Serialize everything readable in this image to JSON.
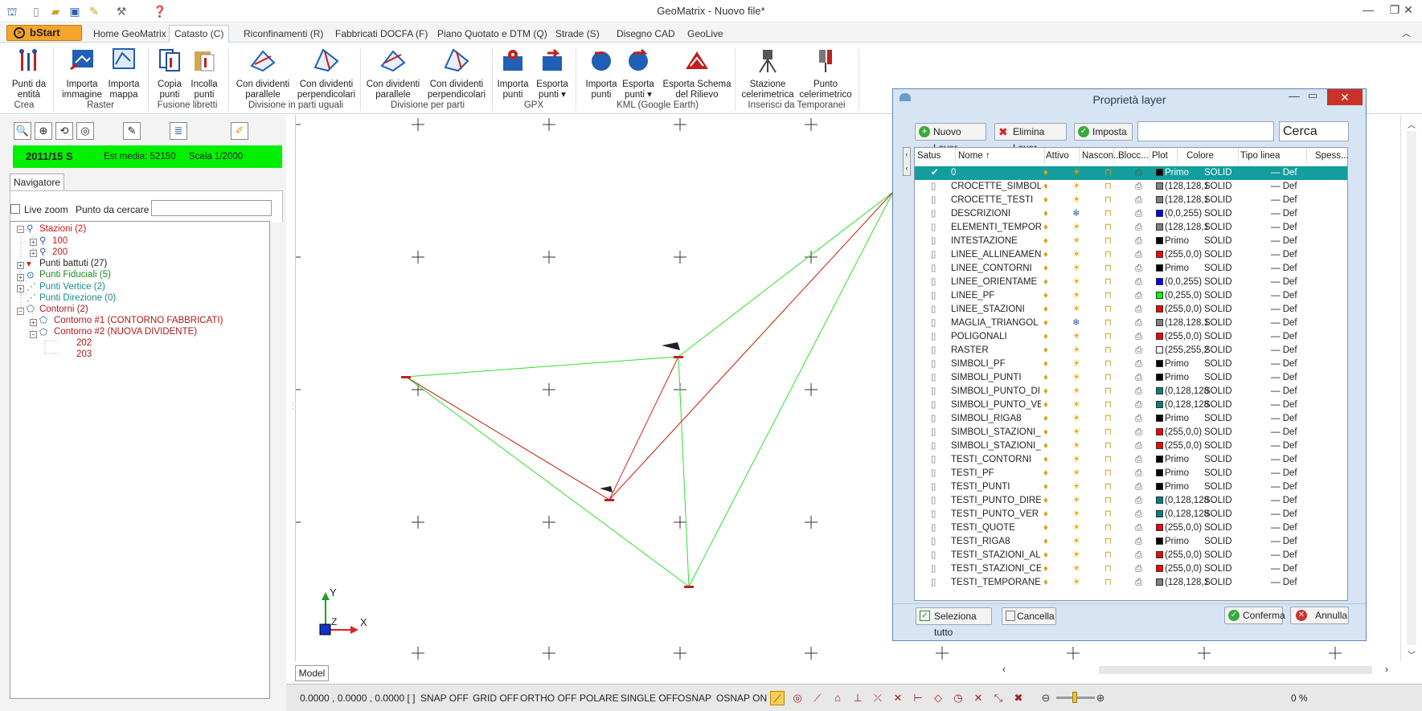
{
  "app": {
    "title": "GeoMatrix - Nuovo file*"
  },
  "tabs": [
    "Home GeoMatrix",
    "Catasto (C)",
    "Riconfinamenti (R)",
    "Fabbricati DOCFA (F)",
    "Piano Quotato e DTM (Q)",
    "Strade (S)",
    "Disegno CAD",
    "GeoLive"
  ],
  "bstart": "bStart",
  "ribbon": {
    "buttons": [
      {
        "l1": "Punti da",
        "l2": "entità"
      },
      {
        "l1": "Importa",
        "l2": "immagine"
      },
      {
        "l1": "Importa",
        "l2": "mappa"
      },
      {
        "l1": "Copia",
        "l2": "punti"
      },
      {
        "l1": "Incolla",
        "l2": "punti"
      },
      {
        "l1": "Con dividenti",
        "l2": "parallele"
      },
      {
        "l1": "Con dividenti",
        "l2": "perpendicolari"
      },
      {
        "l1": "Con dividenti",
        "l2": "parallele"
      },
      {
        "l1": "Con dividenti",
        "l2": "perpendicolari"
      },
      {
        "l1": "Importa",
        "l2": "punti"
      },
      {
        "l1": "Esporta",
        "l2": "punti ▾"
      },
      {
        "l1": "Importa",
        "l2": "punti"
      },
      {
        "l1": "Esporta",
        "l2": "punti ▾"
      },
      {
        "l1": "Esporta Schema",
        "l2": "del Rilievo"
      },
      {
        "l1": "Stazione",
        "l2": "celerimetrica"
      },
      {
        "l1": "Punto",
        "l2": "celerimetrico"
      }
    ],
    "groups": [
      "Crea",
      "Raster",
      "Fusione libretti",
      "Divisione in parti uguali",
      "Divisione per parti",
      "GPX",
      "KML (Google Earth)",
      "Inserisci da Temporanei"
    ]
  },
  "infobar": {
    "code": "2011/15 S",
    "est": "Est media: 52150",
    "scala": "Scala 1/2000"
  },
  "navigator": {
    "tab": "Navigatore",
    "live_zoom": "Live zoom",
    "search_label": "Punto da cercare",
    "search_value": "",
    "tree": [
      {
        "label": "Stazioni (2)",
        "color": "#d01818"
      },
      {
        "label": "100",
        "color": "#d01818"
      },
      {
        "label": "200",
        "color": "#d01818"
      },
      {
        "label": "Punti battuti (27)",
        "color": "#222222"
      },
      {
        "label": "Punti Fiduciali (5)",
        "color": "#1a8a1a"
      },
      {
        "label": "Punti Vertice (2)",
        "color": "#1a8a8a"
      },
      {
        "label": "Punti Direzione (0)",
        "color": "#1a8a8a"
      },
      {
        "label": "Contorni (2)",
        "color": "#b01818"
      },
      {
        "label": "Contorno #1 (CONTORNO FABBRICATI)",
        "color": "#b01818"
      },
      {
        "label": "Contorno #2 (NUOVA DIVIDENTE)",
        "color": "#b01818"
      },
      {
        "label": "202",
        "color": "#b01818"
      },
      {
        "label": "203",
        "color": "#b01818"
      }
    ]
  },
  "canvas": {
    "axis_y": "Y",
    "axis_x": "X",
    "axis_z": "Z"
  },
  "model_tab": "Model",
  "status": {
    "coords": "0.0000 , 0.0000 , 0.0000 [ ]",
    "items": [
      "SNAP OFF",
      "GRID OFF",
      "ORTHO OFF",
      "POLARE",
      "SINGLE OFF",
      "OSNAP",
      "OSNAP ON"
    ],
    "percent": "0 %"
  },
  "dialog": {
    "title": "Proprietà layer",
    "btn_new": "Nuovo Layer",
    "btn_delete": "Elimina Layer",
    "btn_set": "Imposta",
    "search_value": "",
    "btn_search": "Cerca",
    "columns": [
      "Satus",
      "Nome ↑",
      "Attivo",
      "Nascon...",
      "Blocc...",
      "Plot",
      "Colore",
      "Tipo linea",
      "Spess..."
    ],
    "rows": [
      {
        "name": "0",
        "color": "Primo",
        "sw": "#000000",
        "type": "SOLID",
        "w": "— Def",
        "sel": true
      },
      {
        "name": "CROCETTE_SIMBOL",
        "color": "(128,128,1",
        "sw": "#808080",
        "type": "SOLID",
        "w": "— Def"
      },
      {
        "name": "CROCETTE_TESTI",
        "color": "(128,128,1",
        "sw": "#808080",
        "type": "SOLID",
        "w": "— Def"
      },
      {
        "name": "DESCRIZIONI",
        "color": "(0,0,255)",
        "sw": "#0000ff",
        "type": "SOLID",
        "w": "— Def",
        "frozen": true
      },
      {
        "name": "ELEMENTI_TEMPOR",
        "color": "(128,128,1",
        "sw": "#808080",
        "type": "SOLID",
        "w": "— Def"
      },
      {
        "name": "INTESTAZIONE",
        "color": "Primo",
        "sw": "#000000",
        "type": "SOLID",
        "w": "— Def"
      },
      {
        "name": "LINEE_ALLINEAMEN",
        "color": "(255,0,0)",
        "sw": "#ff0000",
        "type": "SOLID",
        "w": "— Def"
      },
      {
        "name": "LINEE_CONTORNI",
        "color": "Primo",
        "sw": "#000000",
        "type": "SOLID",
        "w": "— Def"
      },
      {
        "name": "LINEE_ORIENTAME",
        "color": "(0,0,255)",
        "sw": "#0000ff",
        "type": "SOLID",
        "w": "— Def"
      },
      {
        "name": "LINEE_PF",
        "color": "(0,255,0)",
        "sw": "#00ff00",
        "type": "SOLID",
        "w": "— Def"
      },
      {
        "name": "LINEE_STAZIONI",
        "color": "(255,0,0)",
        "sw": "#ff0000",
        "type": "SOLID",
        "w": "— Def"
      },
      {
        "name": "MAGLIA_TRIANGOL",
        "color": "(128,128,1",
        "sw": "#808080",
        "type": "SOLID",
        "w": "— Def",
        "frozen": true
      },
      {
        "name": "POLIGONALI",
        "color": "(255,0,0)",
        "sw": "#ff0000",
        "type": "SOLID",
        "w": "— Def"
      },
      {
        "name": "RASTER",
        "color": "(255,255,2",
        "sw": "#ffffff",
        "type": "SOLID",
        "w": "— Def"
      },
      {
        "name": "SIMBOLI_PF",
        "color": "Primo",
        "sw": "#000000",
        "type": "SOLID",
        "w": "— Def"
      },
      {
        "name": "SIMBOLI_PUNTI",
        "color": "Primo",
        "sw": "#000000",
        "type": "SOLID",
        "w": "— Def"
      },
      {
        "name": "SIMBOLI_PUNTO_DI",
        "color": "(0,128,128",
        "sw": "#008080",
        "type": "SOLID",
        "w": "— Def"
      },
      {
        "name": "SIMBOLI_PUNTO_VE",
        "color": "(0,128,128",
        "sw": "#008080",
        "type": "SOLID",
        "w": "— Def"
      },
      {
        "name": "SIMBOLI_RIGA8",
        "color": "Primo",
        "sw": "#000000",
        "type": "SOLID",
        "w": "— Def"
      },
      {
        "name": "SIMBOLI_STAZIONI_",
        "color": "(255,0,0)",
        "sw": "#ff0000",
        "type": "SOLID",
        "w": "— Def"
      },
      {
        "name": "SIMBOLI_STAZIONI_",
        "color": "(255,0,0)",
        "sw": "#ff0000",
        "type": "SOLID",
        "w": "— Def"
      },
      {
        "name": "TESTI_CONTORNI",
        "color": "Primo",
        "sw": "#000000",
        "type": "SOLID",
        "w": "— Def"
      },
      {
        "name": "TESTI_PF",
        "color": "Primo",
        "sw": "#000000",
        "type": "SOLID",
        "w": "— Def"
      },
      {
        "name": "TESTI_PUNTI",
        "color": "Primo",
        "sw": "#000000",
        "type": "SOLID",
        "w": "— Def"
      },
      {
        "name": "TESTI_PUNTO_DIRE",
        "color": "(0,128,128",
        "sw": "#008080",
        "type": "SOLID",
        "w": "— Def"
      },
      {
        "name": "TESTI_PUNTO_VER",
        "color": "(0,128,128",
        "sw": "#008080",
        "type": "SOLID",
        "w": "— Def"
      },
      {
        "name": "TESTI_QUOTE",
        "color": "(255,0,0)",
        "sw": "#ff0000",
        "type": "SOLID",
        "w": "— Def"
      },
      {
        "name": "TESTI_RIGA8",
        "color": "Primo",
        "sw": "#000000",
        "type": "SOLID",
        "w": "— Def"
      },
      {
        "name": "TESTI_STAZIONI_AL",
        "color": "(255,0,0)",
        "sw": "#ff0000",
        "type": "SOLID",
        "w": "— Def"
      },
      {
        "name": "TESTI_STAZIONI_CE",
        "color": "(255,0,0)",
        "sw": "#ff0000",
        "type": "SOLID",
        "w": "— Def"
      },
      {
        "name": "TESTI_TEMPORANEI",
        "color": "(128,128,1",
        "sw": "#808080",
        "type": "SOLID",
        "w": "— Def"
      }
    ],
    "btn_select_all": "Seleziona tutto",
    "btn_clear": "Cancella",
    "btn_confirm": "Conferma",
    "btn_cancel": "Annulla"
  }
}
